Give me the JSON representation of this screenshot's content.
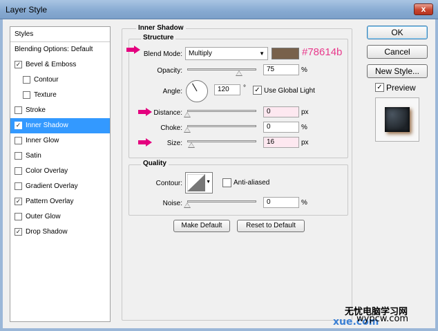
{
  "window": {
    "title": "Layer Style",
    "close_glyph": "x"
  },
  "styles_list": {
    "header": "Styles",
    "items": [
      {
        "label": "Blending Options: Default",
        "has_checkbox": false,
        "checked": false,
        "selected": false,
        "indent": 0
      },
      {
        "label": "Bevel & Emboss",
        "has_checkbox": true,
        "checked": true,
        "selected": false,
        "indent": 0
      },
      {
        "label": "Contour",
        "has_checkbox": true,
        "checked": false,
        "selected": false,
        "indent": 1
      },
      {
        "label": "Texture",
        "has_checkbox": true,
        "checked": false,
        "selected": false,
        "indent": 1
      },
      {
        "label": "Stroke",
        "has_checkbox": true,
        "checked": false,
        "selected": false,
        "indent": 0
      },
      {
        "label": "Inner Shadow",
        "has_checkbox": true,
        "checked": true,
        "selected": true,
        "indent": 0
      },
      {
        "label": "Inner Glow",
        "has_checkbox": true,
        "checked": false,
        "selected": false,
        "indent": 0
      },
      {
        "label": "Satin",
        "has_checkbox": true,
        "checked": false,
        "selected": false,
        "indent": 0
      },
      {
        "label": "Color Overlay",
        "has_checkbox": true,
        "checked": false,
        "selected": false,
        "indent": 0
      },
      {
        "label": "Gradient Overlay",
        "has_checkbox": true,
        "checked": false,
        "selected": false,
        "indent": 0
      },
      {
        "label": "Pattern Overlay",
        "has_checkbox": true,
        "checked": true,
        "selected": false,
        "indent": 0
      },
      {
        "label": "Outer Glow",
        "has_checkbox": true,
        "checked": false,
        "selected": false,
        "indent": 0
      },
      {
        "label": "Drop Shadow",
        "has_checkbox": true,
        "checked": true,
        "selected": false,
        "indent": 0
      }
    ]
  },
  "inner_shadow": {
    "title": "Inner Shadow",
    "structure": {
      "title": "Structure",
      "blend_mode_label": "Blend Mode:",
      "blend_mode_value": "Multiply",
      "color_swatch": "#78614b",
      "color_annotation": "#78614b",
      "opacity_label": "Opacity:",
      "opacity_value": "75",
      "opacity_unit": "%",
      "opacity_level": 0.75,
      "angle_label": "Angle:",
      "angle_value": "120",
      "angle_unit": "°",
      "use_global_light_label": "Use Global Light",
      "use_global_light_checked": true,
      "distance_label": "Distance:",
      "distance_value": "0",
      "distance_unit": "px",
      "distance_level": 0,
      "choke_label": "Choke:",
      "choke_value": "0",
      "choke_unit": "%",
      "choke_level": 0,
      "size_label": "Size:",
      "size_value": "16",
      "size_unit": "px",
      "size_level": 0.064
    },
    "quality": {
      "title": "Quality",
      "contour_label": "Contour:",
      "anti_aliased_label": "Anti-aliased",
      "anti_aliased_checked": false,
      "noise_label": "Noise:",
      "noise_value": "0",
      "noise_unit": "%",
      "noise_level": 0
    },
    "make_default_label": "Make Default",
    "reset_default_label": "Reset to Default"
  },
  "right_panel": {
    "ok_label": "OK",
    "cancel_label": "Cancel",
    "new_style_label": "New Style...",
    "preview_label": "Preview",
    "preview_checked": true
  },
  "watermark": {
    "line1": "无忧电脑学习网",
    "line2": "wypcw.com",
    "line3": "xue.com"
  },
  "colors": {
    "highlight_arrow": "#e4007f",
    "selected_row": "#3399ff",
    "annotation_text": "#e83a8c"
  },
  "icons": [
    "close-icon",
    "dropdown-arrow-icon",
    "angle-dial-icon",
    "contour-curve-icon",
    "highlight-arrow-icon",
    "checkmark-icon"
  ]
}
